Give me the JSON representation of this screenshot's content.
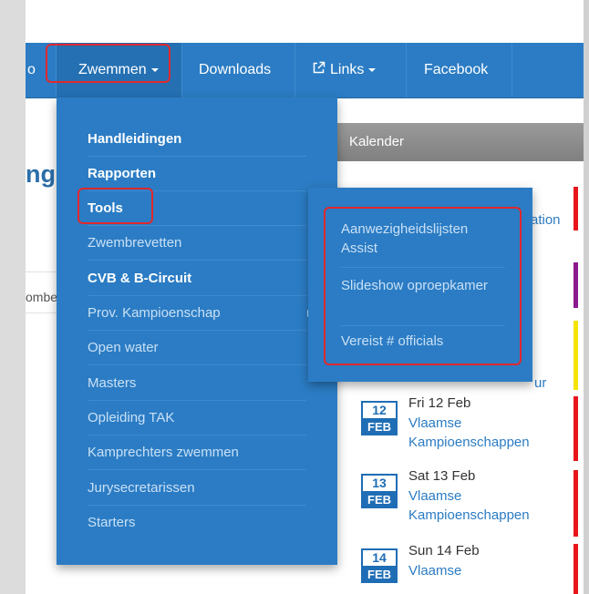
{
  "navbar": {
    "partial_item": "o",
    "items": [
      {
        "label": "Zwemmen",
        "has_caret": true
      },
      {
        "label": "Downloads"
      },
      {
        "label": "Links",
        "has_caret": true,
        "icon": "external-link-icon"
      },
      {
        "label": "Facebook"
      }
    ]
  },
  "content": {
    "heading_fragment": "ng",
    "sidebar_fragment": "ombe"
  },
  "calendar": {
    "header": "Kalender",
    "fragments": [
      "ation",
      "ur"
    ],
    "events": [
      {
        "day": "12",
        "month": "FEB",
        "date": "Fri 12 Feb",
        "title": "Vlaamse Kampioenschappen"
      },
      {
        "day": "13",
        "month": "FEB",
        "date": "Sat 13 Feb",
        "title": "Vlaamse Kampioenschappen"
      },
      {
        "day": "14",
        "month": "FEB",
        "date": "Sun 14 Feb",
        "title": "Vlaamse"
      }
    ],
    "stripe_colors": [
      "#e8151b",
      "#8b1a8f",
      "#f5e300",
      "#e8151b",
      "#e8151b",
      "#e8151b"
    ]
  },
  "dropdown": {
    "items": [
      {
        "label": "Handleidingen",
        "style": "bold"
      },
      {
        "label": "Rapporten",
        "style": "bold"
      },
      {
        "label": "Tools",
        "style": "bold"
      },
      {
        "label": "Zwembrevetten",
        "style": "light"
      },
      {
        "label": "CVB & B-Circuit",
        "style": "bold"
      },
      {
        "label": "Prov. Kampioenschap",
        "style": "light",
        "has_submenu": true
      },
      {
        "label": "Open water",
        "style": "light"
      },
      {
        "label": "Masters",
        "style": "light"
      },
      {
        "label": "Opleiding TAK",
        "style": "light"
      },
      {
        "label": "Kamprechters zwemmen",
        "style": "light"
      },
      {
        "label": "Jurysecretarissen",
        "style": "light"
      },
      {
        "label": "Starters",
        "style": "light"
      }
    ]
  },
  "submenu": {
    "items": [
      {
        "label": "Aanwezigheidslijsten Assist"
      },
      {
        "label": "Slideshow oproepkamer"
      },
      {
        "label": "Vereist # officials"
      }
    ]
  },
  "colors": {
    "navbar": "#2b7cc4",
    "highlight": "#e0282e",
    "calendar_header": "#8c8c8c"
  }
}
